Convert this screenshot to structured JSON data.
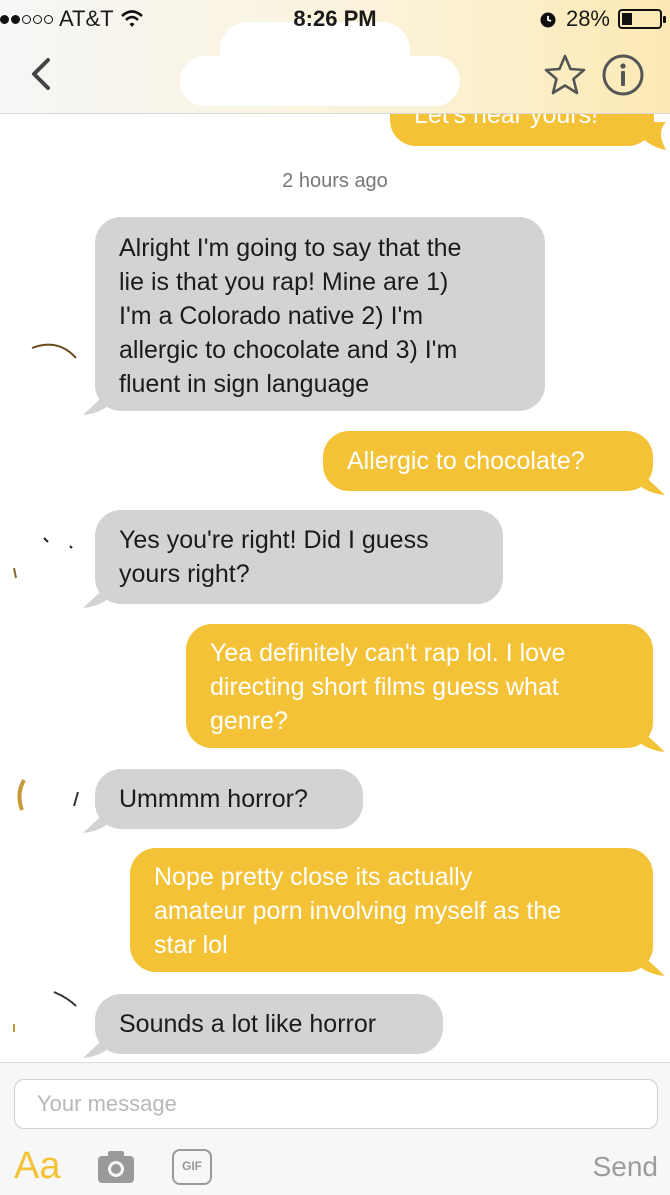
{
  "status_bar": {
    "carrier": "AT&T",
    "time": "8:26 PM",
    "battery": "28%",
    "battery_level": 0.28,
    "signal_bars_filled": 2
  },
  "header": {
    "back_icon": "chevron-left-icon",
    "star_icon": "star-icon",
    "info_icon": "info-icon"
  },
  "messages": {
    "partial_top": "Let's hear yours!",
    "timestamp": "2 hours ago",
    "m1": "Alright I'm going to say that the\nlie is that you rap! Mine are 1)\nI'm a Colorado native 2) I'm\nallergic to chocolate and 3) I'm\nfluent in sign language",
    "m2": "Allergic to chocolate?",
    "m3": "Yes you're right! Did I guess\nyours right?",
    "m4": "Yea definitely can't rap lol. I love\ndirecting short films guess what\ngenre?",
    "m5": "Ummmm horror?",
    "m6": "Nope pretty close its actually\namateur porn involving myself as the\nstar lol",
    "m7": "Sounds a lot like horror"
  },
  "composer": {
    "placeholder": "Your message",
    "aa_label": "Aa",
    "gif_label": "GIF",
    "send_label": "Send",
    "camera_icon": "camera-icon"
  },
  "colors": {
    "accent_yellow": "#f4c236",
    "their_bubble": "#d3d3d3"
  }
}
